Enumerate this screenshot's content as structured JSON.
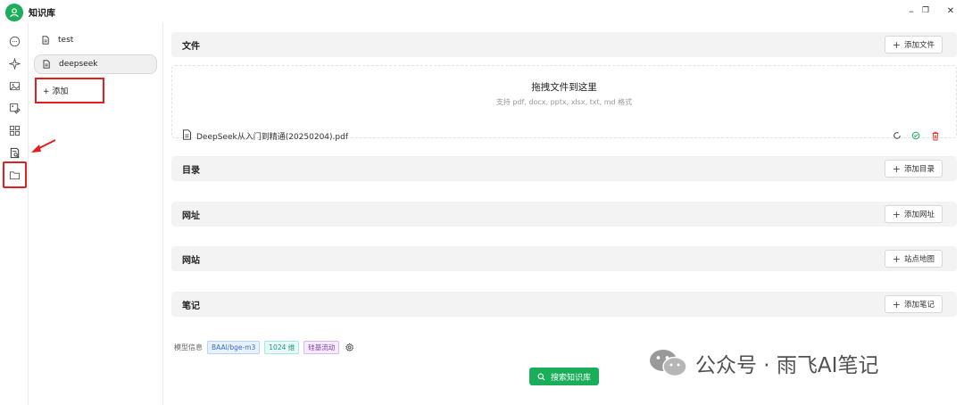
{
  "app": {
    "title": "知识库"
  },
  "window_controls": {
    "minimize": "–",
    "maximize": "❐",
    "close": "✕"
  },
  "rail": {
    "items": [
      {
        "name": "chat-icon"
      },
      {
        "name": "sparkle-icon"
      },
      {
        "name": "image-icon"
      },
      {
        "name": "image-edit-icon"
      },
      {
        "name": "grid-icon"
      },
      {
        "name": "knowledge-base-icon",
        "active": true
      },
      {
        "name": "folder-icon"
      }
    ]
  },
  "kb_list": {
    "items": [
      {
        "label": "test",
        "icon": "file-icon"
      },
      {
        "label": "deepseek",
        "icon": "file-icon",
        "selected": true
      }
    ],
    "add_label": "+ 添加"
  },
  "sections": {
    "files": {
      "title": "文件",
      "button": "添加文件"
    },
    "directory": {
      "title": "目录",
      "button": "添加目录"
    },
    "url": {
      "title": "网址",
      "button": "添加网址"
    },
    "website": {
      "title": "网站",
      "button": "站点地图"
    },
    "notes": {
      "title": "笔记",
      "button": "添加笔记"
    }
  },
  "dropzone": {
    "title": "拖拽文件到这里",
    "subtitle": "支持 pdf, docx, pptx, xlsx, txt, md 格式"
  },
  "files": [
    {
      "name": "DeepSeek从入门到精通(20250204).pdf",
      "status": "completed"
    }
  ],
  "model_info": {
    "label": "模型信息",
    "model": "BAAI/bge-m3",
    "dimensions": "1024 维",
    "provider": "硅基流动"
  },
  "search_button": {
    "label": "搜索知识库"
  },
  "watermark": {
    "text": "公众号 · 雨飞AI笔记"
  },
  "colors": {
    "accent": "#1aad5a",
    "highlight": "#e02020",
    "section_bg": "#f3f3f3"
  }
}
